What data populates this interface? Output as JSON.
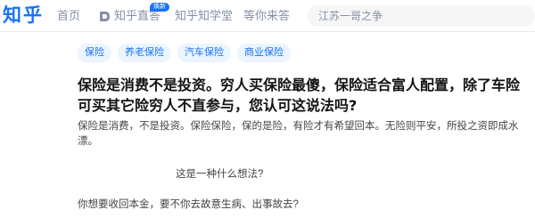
{
  "header": {
    "logo": "知乎",
    "nav": {
      "home": "首页",
      "zhida": "知乎直答",
      "zhida_badge": "焕新",
      "xuetang": "知乎知学堂",
      "wait": "等你来答"
    },
    "search": {
      "placeholder": "江苏一哥之争"
    }
  },
  "tags": [
    "保险",
    "养老保险",
    "汽车保险",
    "商业保险"
  ],
  "question": {
    "title": "保险是消费不是投资。穷人买保险最傻，保险适合富人配置，除了车险可买其它险穷人不直参与，您认可这说法吗?",
    "body": "保险是消费，不是投资。保险保险，保的是险，有险才有希望回本。无险则平安，所投之资即成水漂。",
    "line2": "这是一种什么想法?",
    "line3": "你想要收回本金，要不你去故意生病、出事故去?"
  },
  "colors": {
    "brand": "#1772f6",
    "tag_bg": "#ebf5ff",
    "nav_text": "#8590a6"
  }
}
